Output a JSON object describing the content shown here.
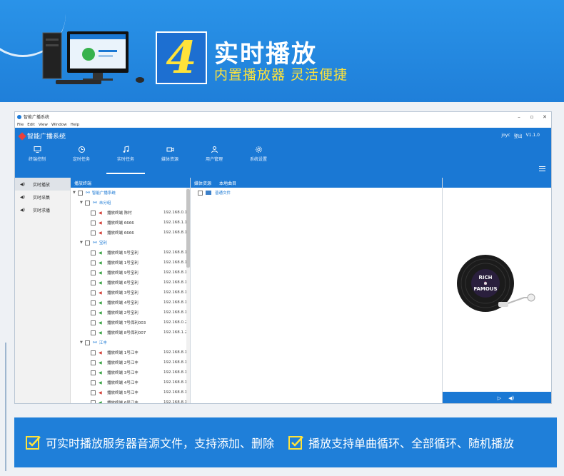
{
  "banner": {
    "number": "4",
    "title": "实时播放",
    "subtitle": "内置播放器 灵活便捷"
  },
  "window": {
    "title": "智能广播系统",
    "menus": [
      "File",
      "Edit",
      "View",
      "Window",
      "Help"
    ],
    "app_name": "智能广播系统",
    "user": "joyc",
    "logout": "登出",
    "version": "V1.1.0",
    "nav": [
      {
        "label": "终端控制",
        "icon": "monitor-icon"
      },
      {
        "label": "定时任务",
        "icon": "clock-icon"
      },
      {
        "label": "实时任务",
        "icon": "music-icon",
        "active": true
      },
      {
        "label": "媒体资源",
        "icon": "video-icon"
      },
      {
        "label": "用户管理",
        "icon": "user-icon"
      },
      {
        "label": "系统设置",
        "icon": "gear-icon"
      }
    ],
    "sidebar": [
      {
        "label": "实时播放",
        "active": true
      },
      {
        "label": "实时采集"
      },
      {
        "label": "实时求播"
      }
    ],
    "tree_header": "播放终端",
    "tree": {
      "root": "智能广播系统",
      "groups": [
        {
          "name": "未分组",
          "items": [
            {
              "name": "播放终端 陈村",
              "ip": "192.168.0.1",
              "status": "red"
            },
            {
              "name": "播放终端 6666",
              "ip": "192.168.1.1",
              "status": "red"
            },
            {
              "name": "播放终端 6666",
              "ip": "192.168.8.1",
              "status": "red"
            }
          ]
        },
        {
          "name": "宝利",
          "items": [
            {
              "name": "播放终端 5号宝利",
              "ip": "192.168.8.1",
              "status": "green"
            },
            {
              "name": "播放终端 1号宝利",
              "ip": "192.168.8.1",
              "status": "green"
            },
            {
              "name": "播放终端 9号宝利",
              "ip": "192.168.8.1",
              "status": "green"
            },
            {
              "name": "播放终端 6号宝利",
              "ip": "192.168.8.1",
              "status": "green"
            },
            {
              "name": "播放终端 3号宝利",
              "ip": "192.168.8.1",
              "status": "red"
            },
            {
              "name": "播放终端 4号宝利",
              "ip": "192.168.8.1",
              "status": "green"
            },
            {
              "name": "播放终端 2号宝利",
              "ip": "192.168.8.1",
              "status": "green"
            },
            {
              "name": "播放终端 7号保利003",
              "ip": "192.168.0.2",
              "status": "green"
            },
            {
              "name": "播放终端 8号保利007",
              "ip": "192.168.1.2",
              "status": "green"
            }
          ]
        },
        {
          "name": "江丰",
          "items": [
            {
              "name": "播放终端 1号江丰",
              "ip": "192.168.8.1",
              "status": "red"
            },
            {
              "name": "播放终端 2号江丰",
              "ip": "192.168.8.1",
              "status": "green"
            },
            {
              "name": "播放终端 3号江丰",
              "ip": "192.168.8.1",
              "status": "green"
            },
            {
              "name": "播放终端 4号江丰",
              "ip": "192.168.8.1",
              "status": "green"
            },
            {
              "name": "播放终端 5号江丰",
              "ip": "192.168.8.1",
              "status": "red"
            },
            {
              "name": "播放终端 6号江丰",
              "ip": "192.168.8.1",
              "status": "green"
            },
            {
              "name": "播放终端 7号江丰",
              "ip": "192.168.8.1",
              "status": "green"
            }
          ]
        }
      ]
    },
    "media_tabs": [
      "媒体资源",
      "本地曲目"
    ],
    "media_items": [
      "普通文件"
    ],
    "record": {
      "line1": "RICH",
      "line2": "&",
      "line3": "FAMOUS"
    }
  },
  "features": [
    "可实时播放服务器音源文件，支持添加、删除",
    "播放支持单曲循环、全部循环、随机播放"
  ],
  "colors": {
    "primary": "#1a78d4",
    "accent": "#ffe33a"
  }
}
